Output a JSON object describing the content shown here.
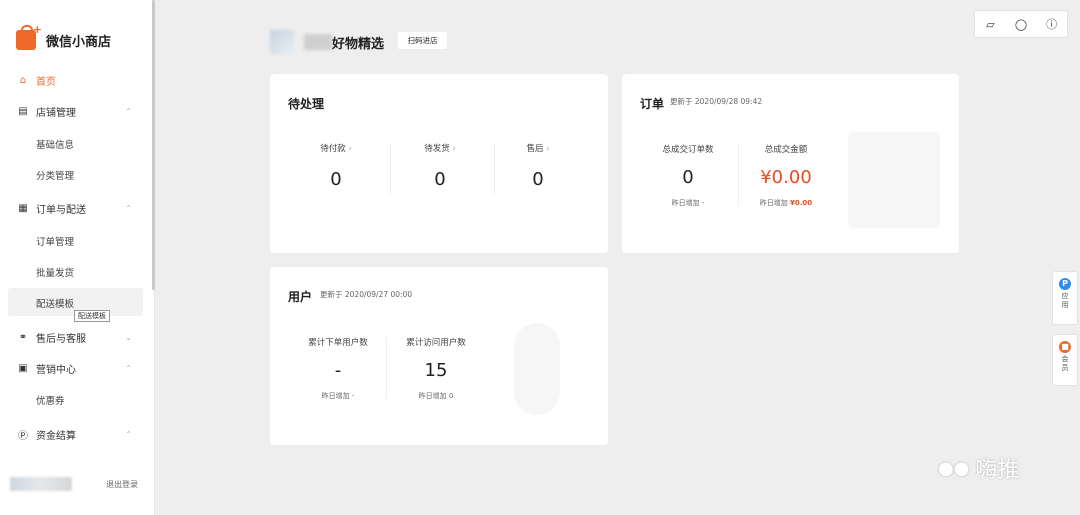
{
  "app": {
    "name": "微信小商店"
  },
  "sidebar": {
    "home": "首页",
    "store_mgmt": {
      "label": "店铺管理",
      "items": [
        "基础信息",
        "分类管理"
      ]
    },
    "orders": {
      "label": "订单与配送",
      "items": [
        "订单管理",
        "批量发货",
        "配送模板"
      ]
    },
    "tooltip": "配送模板",
    "aftersales": "售后与客服",
    "marketing": {
      "label": "营销中心",
      "items": [
        "优惠券"
      ]
    },
    "finance": "资金结算",
    "logout": "退出登录"
  },
  "header": {
    "shop_name": "好物精选",
    "scan_button": "扫码进店"
  },
  "pending": {
    "title": "待处理",
    "items": [
      {
        "label": "待付款",
        "value": "0"
      },
      {
        "label": "待发货",
        "value": "0"
      },
      {
        "label": "售后",
        "value": "0"
      }
    ]
  },
  "orders_card": {
    "title": "订单",
    "updated": "更新于 2020/09/28 09:42",
    "count_label": "总成交订单数",
    "count_value": "0",
    "count_sub": "昨日增加  -",
    "amount_label": "总成交金额",
    "amount_value": "¥0.00",
    "amount_sub_label": "昨日增加",
    "amount_sub_value": "¥0.00"
  },
  "users_card": {
    "title": "用户",
    "updated": "更新于 2020/09/27 00:00",
    "buyers_label": "累计下单用户数",
    "buyers_value": "-",
    "buyers_sub": "昨日增加  -",
    "visitors_label": "累计访问用户数",
    "visitors_value": "15",
    "visitors_sub": "昨日增加  0"
  },
  "floating": {
    "apps": "应用",
    "member": "会员"
  },
  "watermark": "嗨推",
  "colors": {
    "accent": "#ee6a28",
    "red": "#f04a1e"
  }
}
